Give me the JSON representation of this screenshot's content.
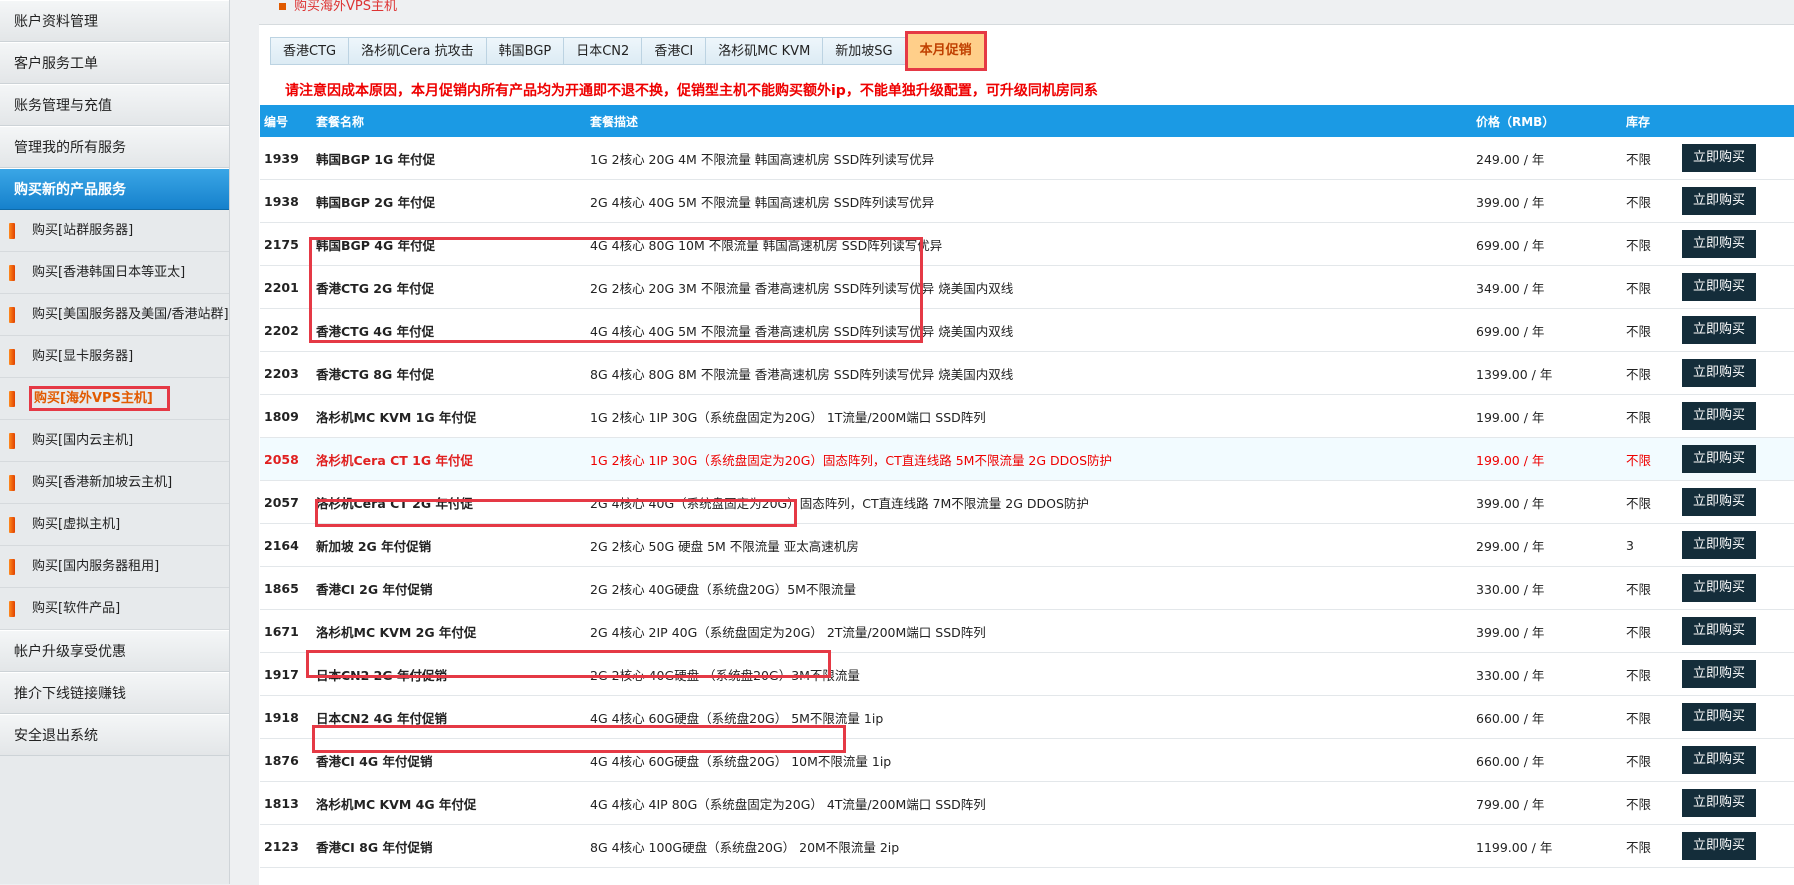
{
  "sidebar": {
    "top_items": [
      "账户资料管理",
      "客户服务工单",
      "账务管理与充值",
      "管理我的所有服务"
    ],
    "section": "购买新的产品服务",
    "sub_items": [
      "购买[站群服务器]",
      "购买[香港韩国日本等亚太]",
      "购买[美国服务器及美国/香港站群]",
      "购买[显卡服务器]",
      "购买[海外VPS主机]",
      "购买[国内云主机]",
      "购买[香港新加坡云主机]",
      "购买[虚拟主机]",
      "购买[国内服务器租用]",
      "购买[软件产品]"
    ],
    "bottom_items": [
      "帐户升级享受优惠",
      "推介下线链接赚钱",
      "安全退出系统"
    ]
  },
  "page_title": "购买海外VPS主机",
  "tabs": [
    "香港CTG",
    "洛杉矶Cera 抗攻击",
    "韩国BGP",
    "日本CN2",
    "香港CI",
    "洛杉矶MC KVM",
    "新加坡SG",
    "本月促销"
  ],
  "notice": "请注意因成本原因，本月促销内所有产品均为开通即不退不换，促销型主机不能购买额外ip，不能单独升级配置，可升级同机房同系",
  "table": {
    "headers": [
      "编号",
      "套餐名称",
      "套餐描述",
      "价格（RMB）",
      "库存",
      ""
    ],
    "buy_label": "立即购买",
    "rows": [
      {
        "id": "1939",
        "name": "韩国BGP 1G 年付促",
        "desc": "1G 2核心 20G 4M 不限流量 韩国高速机房 SSD阵列读写优异",
        "price": "249.00 / 年",
        "stock": "不限"
      },
      {
        "id": "1938",
        "name": "韩国BGP 2G 年付促",
        "desc": "2G 4核心 40G 5M 不限流量 韩国高速机房 SSD阵列读写优异",
        "price": "399.00 / 年",
        "stock": "不限"
      },
      {
        "id": "2175",
        "name": "韩国BGP 4G 年付促",
        "desc": "4G 4核心 80G 10M 不限流量 韩国高速机房 SSD阵列读写优异",
        "price": "699.00 / 年",
        "stock": "不限"
      },
      {
        "id": "2201",
        "name": "香港CTG 2G 年付促",
        "desc": "2G 2核心 20G 3M 不限流量 香港高速机房 SSD阵列读写优异 烧美国内双线",
        "price": "349.00 / 年",
        "stock": "不限"
      },
      {
        "id": "2202",
        "name": "香港CTG 4G 年付促",
        "desc": "4G 4核心 40G 5M 不限流量 香港高速机房 SSD阵列读写优异 烧美国内双线",
        "price": "699.00 / 年",
        "stock": "不限"
      },
      {
        "id": "2203",
        "name": "香港CTG 8G 年付促",
        "desc": "8G 4核心 80G 8M 不限流量 香港高速机房 SSD阵列读写优异 烧美国内双线",
        "price": "1399.00 / 年",
        "stock": "不限"
      },
      {
        "id": "1809",
        "name": "洛杉机MC KVM 1G 年付促",
        "desc": "1G 2核心 1IP 30G（系统盘固定为20G） 1T流量/200M端口 SSD阵列",
        "price": "199.00 / 年",
        "stock": "不限"
      },
      {
        "id": "2058",
        "name": "洛杉机Cera CT 1G 年付促",
        "desc": "1G 2核心 1IP 30G（系统盘固定为20G）固态阵列，CT直连线路 5M不限流量   2G DDOS防护",
        "price": "199.00 / 年",
        "stock": "不限",
        "highlight": true
      },
      {
        "id": "2057",
        "name": "洛杉机Cera CT 2G 年付促",
        "desc": "2G 4核心 40G（系统盘固定为20G）固态阵列，CT直连线路 7M不限流量 2G DDOS防护",
        "price": "399.00 / 年",
        "stock": "不限"
      },
      {
        "id": "2164",
        "name": "新加坡 2G 年付促销",
        "desc": "2G 2核心 50G 硬盘 5M 不限流量 亚太高速机房",
        "price": "299.00 / 年",
        "stock": "3"
      },
      {
        "id": "1865",
        "name": "香港CI 2G 年付促销",
        "desc": "2G 2核心 40G硬盘（系统盘20G）5M不限流量",
        "price": "330.00 / 年",
        "stock": "不限"
      },
      {
        "id": "1671",
        "name": "洛杉机MC KVM 2G 年付促",
        "desc": "2G 4核心 2IP 40G（系统盘固定为20G） 2T流量/200M端口 SSD阵列",
        "price": "399.00 / 年",
        "stock": "不限"
      },
      {
        "id": "1917",
        "name": "日本CN2 2G 年付促销",
        "desc": "2G 2核心 40G硬盘 （系统盘20G）3M不限流量",
        "price": "330.00 / 年",
        "stock": "不限"
      },
      {
        "id": "1918",
        "name": "日本CN2 4G 年付促销",
        "desc": "4G 4核心 60G硬盘（系统盘20G） 5M不限流量 1ip",
        "price": "660.00 / 年",
        "stock": "不限"
      },
      {
        "id": "1876",
        "name": "香港CI 4G 年付促销",
        "desc": "4G 4核心 60G硬盘（系统盘20G） 10M不限流量 1ip",
        "price": "660.00 / 年",
        "stock": "不限"
      },
      {
        "id": "1813",
        "name": "洛杉机MC KVM 4G 年付促",
        "desc": "4G 4核心 4IP 80G（系统盘固定为20G） 4T流量/200M端口 SSD阵列",
        "price": "799.00 / 年",
        "stock": "不限"
      },
      {
        "id": "2123",
        "name": "香港CI 8G 年付促销",
        "desc": "8G 4核心 100G硬盘（系统盘20G） 20M不限流量 2ip",
        "price": "1199.00 / 年",
        "stock": "不限"
      }
    ]
  }
}
